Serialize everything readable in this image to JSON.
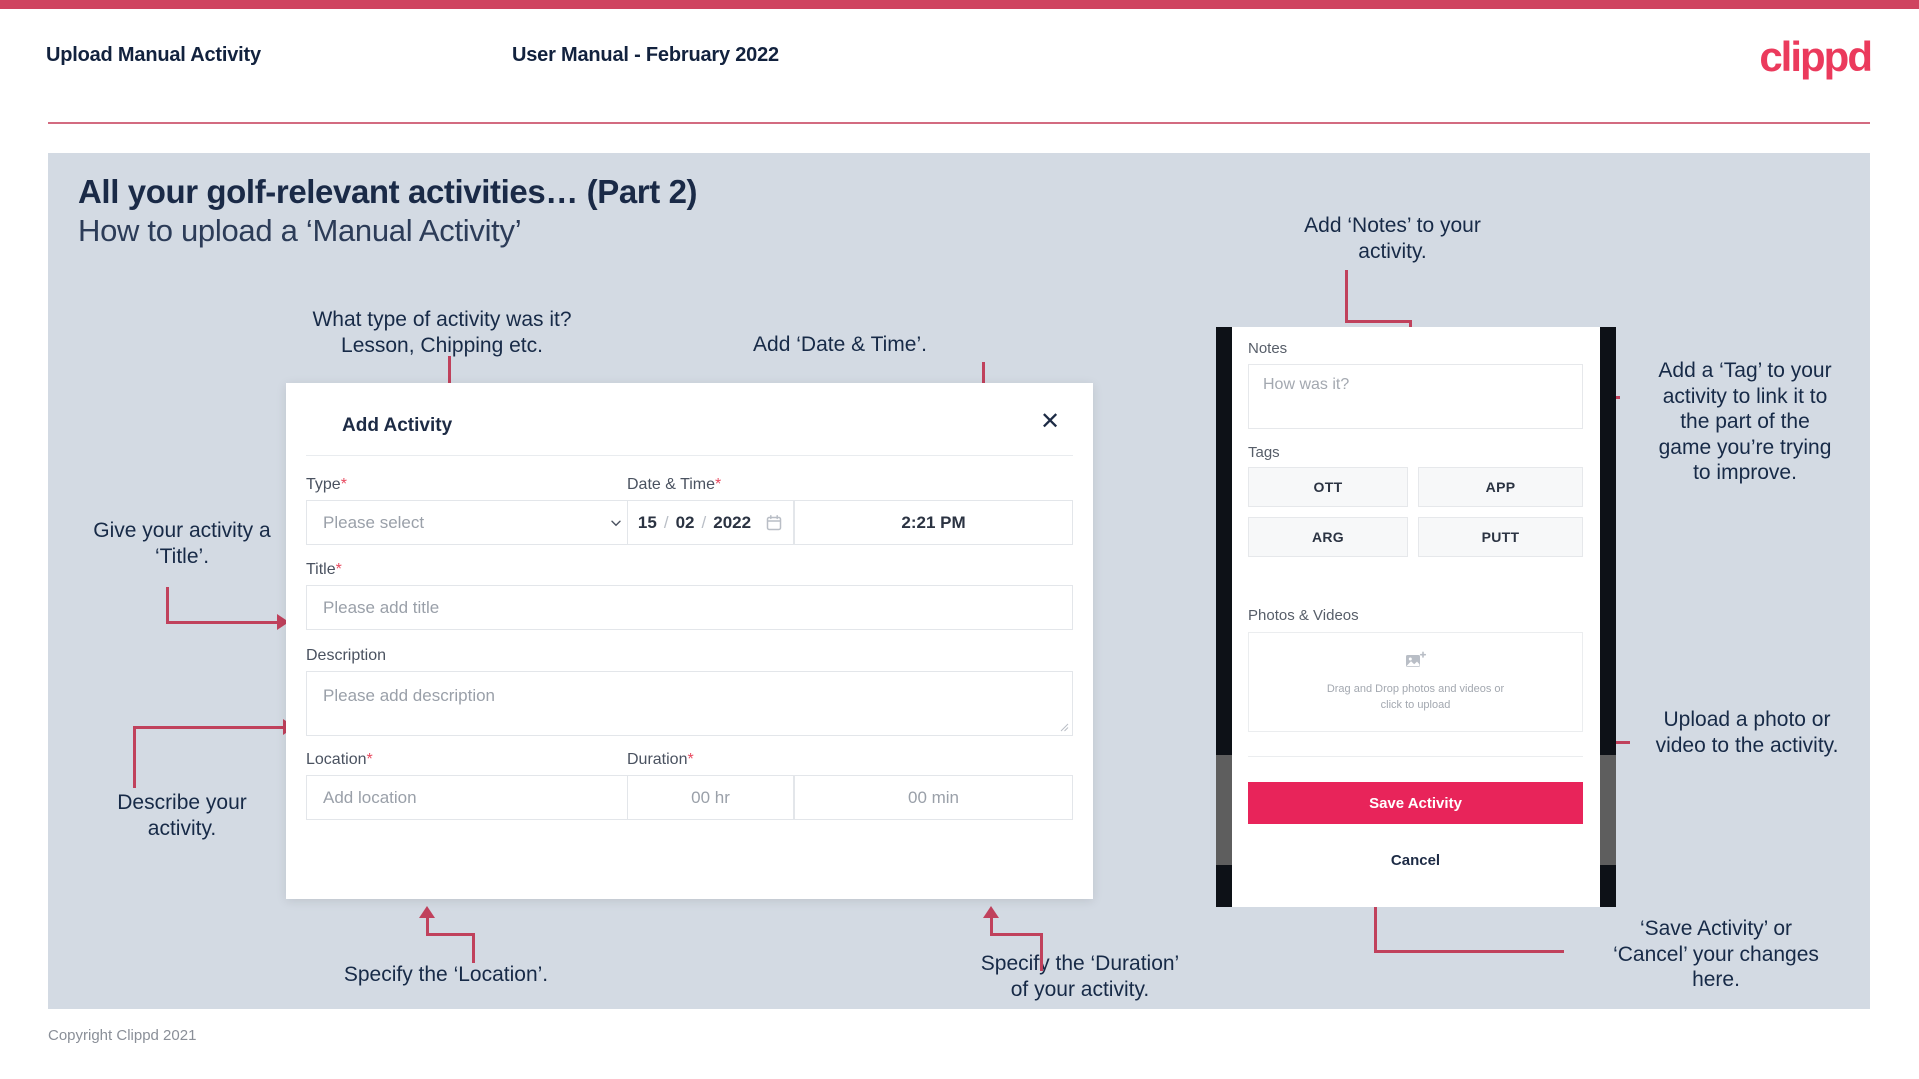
{
  "header": {
    "left_title": "Upload Manual Activity",
    "doc_title": "User Manual - February 2022",
    "logo": "clippd"
  },
  "slide": {
    "title_bold": "All your golf-relevant activities… (Part 2)",
    "title_light": "How to upload a ‘Manual Activity’",
    "copyright": "Copyright Clippd 2021"
  },
  "annotations": {
    "type": "What type of activity was it?\nLesson, Chipping etc.",
    "datetime": "Add ‘Date & Time’.",
    "title": "Give your activity a\n‘Title’.",
    "description": "Describe your\nactivity.",
    "location": "Specify the ‘Location’.",
    "duration": "Specify the ‘Duration’\nof your activity.",
    "notes": "Add ‘Notes’ to your\nactivity.",
    "tags": "Add a ‘Tag’ to your\nactivity to link it to\nthe part of the\ngame you’re trying\nto improve.",
    "upload": "Upload a photo or\nvideo to the activity.",
    "save_cancel": "‘Save Activity’ or\n‘Cancel’ your changes\nhere."
  },
  "dialog": {
    "title": "Add Activity",
    "close_icon": "close-icon",
    "fields": {
      "type": {
        "label": "Type",
        "required": "*",
        "placeholder": "Please select",
        "value": ""
      },
      "datetime": {
        "label": "Date & Time",
        "required": "*",
        "date_day": "15",
        "date_month": "02",
        "date_year": "2022",
        "date_sep": "/",
        "time_value": "2:21 PM"
      },
      "title": {
        "label": "Title",
        "required": "*",
        "placeholder": "Please add title",
        "value": ""
      },
      "description": {
        "label": "Description",
        "required": "",
        "placeholder": "Please add description",
        "value": ""
      },
      "location": {
        "label": "Location",
        "required": "*",
        "placeholder": "Add location",
        "value": ""
      },
      "duration": {
        "label": "Duration",
        "required": "*",
        "hours_placeholder": "00 hr",
        "minutes_placeholder": "00 min"
      }
    }
  },
  "phone": {
    "notes": {
      "label": "Notes",
      "placeholder": "How was it?",
      "value": ""
    },
    "tags": {
      "label": "Tags",
      "items": [
        {
          "label": "OTT"
        },
        {
          "label": "APP"
        },
        {
          "label": "ARG"
        },
        {
          "label": "PUTT"
        }
      ]
    },
    "media": {
      "label": "Photos & Videos",
      "icon": "add-image-icon",
      "dropzone_line1": "Drag and Drop photos and videos or",
      "dropzone_line2": "click to upload"
    },
    "actions": {
      "save_label": "Save Activity",
      "cancel_label": "Cancel"
    }
  },
  "colors": {
    "brand_pink": "#e8245a",
    "accent_crimson": "#cf4460",
    "annotation_line": "#c0415c",
    "slide_bg": "#d3dae3",
    "text_dark": "#1d2b45"
  }
}
